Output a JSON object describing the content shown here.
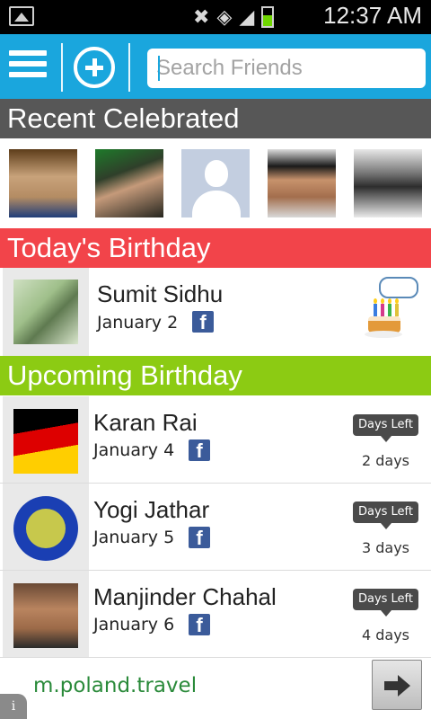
{
  "status_bar": {
    "time": "12:37 AM",
    "icons": [
      "image-icon",
      "mute-icon",
      "wifi-icon",
      "signal-icon",
      "battery-icon"
    ]
  },
  "toolbar": {
    "search_placeholder": "Search Friends",
    "accent_color": "#1aa6dd"
  },
  "sections": {
    "recent": "Recent Celebrated",
    "today": "Today's Birthday",
    "upcoming": "Upcoming Birthday"
  },
  "section_colors": {
    "recent": "#575757",
    "today": "#f2444a",
    "upcoming": "#8ccb13"
  },
  "today": [
    {
      "name": "Sumit Sidhu",
      "date": "January 2"
    }
  ],
  "upcoming": [
    {
      "name": "Karan Rai",
      "date": "January 4",
      "badge": "Days Left",
      "days": "2 days"
    },
    {
      "name": "Yogi Jathar",
      "date": "January 5",
      "badge": "Days Left",
      "days": "3 days"
    },
    {
      "name": "Manjinder Chahal",
      "date": "January 6",
      "badge": "Days Left",
      "days": "4 days"
    }
  ],
  "ad": {
    "text": "m.poland.travel"
  }
}
